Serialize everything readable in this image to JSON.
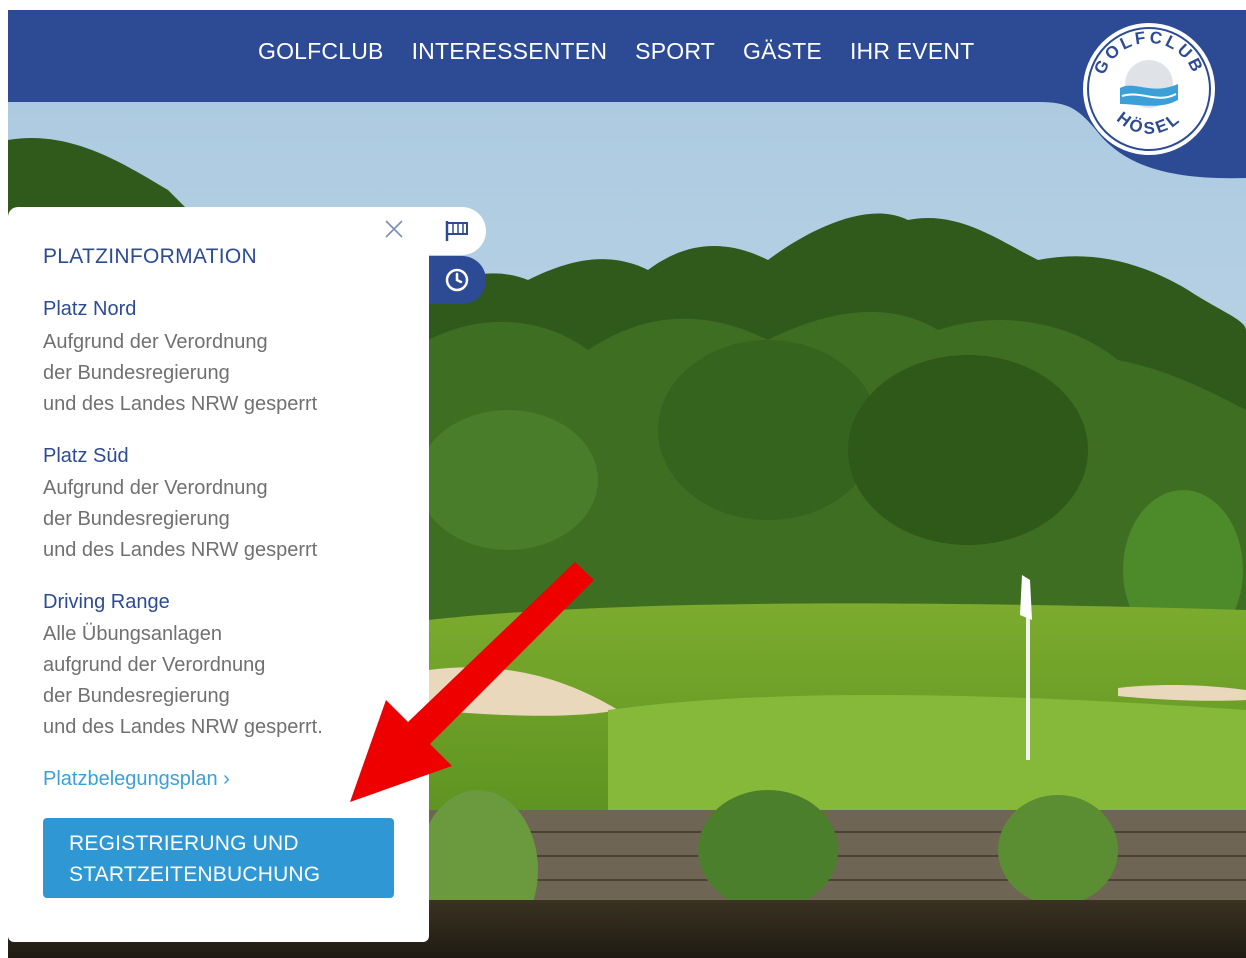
{
  "nav": {
    "items": [
      "GOLFCLUB",
      "INTERESSENTEN",
      "SPORT",
      "GÄSTE",
      "IHR EVENT"
    ]
  },
  "logo": {
    "top_text": "GOLFCLUB",
    "bottom_text": "HÖSEL"
  },
  "panel": {
    "title": "PLATZINFORMATION",
    "sections": [
      {
        "title": "Platz Nord",
        "lines": [
          "Aufgrund der Verordnung",
          "der Bundesregierung",
          "und des Landes NRW gesperrt"
        ]
      },
      {
        "title": "Platz Süd",
        "lines": [
          "Aufgrund der Verordnung",
          "der Bundesregierung",
          "und des Landes NRW gesperrt"
        ]
      },
      {
        "title": "Driving Range",
        "lines": [
          "Alle Übungsanlagen",
          "aufgrund der Verordnung",
          "der Bundesregierung",
          "und des Landes NRW gesperrt."
        ]
      }
    ],
    "plan_link": "Platzbelegungsplan ›",
    "cta_lines": [
      "REGISTRIERUNG UND",
      "STARTZEITENBUCHUNG"
    ]
  },
  "icons": {
    "close": "close-icon",
    "flag": "flag-icon",
    "clock": "clock-icon",
    "arrow": "red-arrow-annotation"
  },
  "colors": {
    "brand_blue": "#2d4b95",
    "cta_blue": "#2f98d4",
    "link_blue": "#3ba0d8",
    "arrow_red": "#ee0000"
  }
}
